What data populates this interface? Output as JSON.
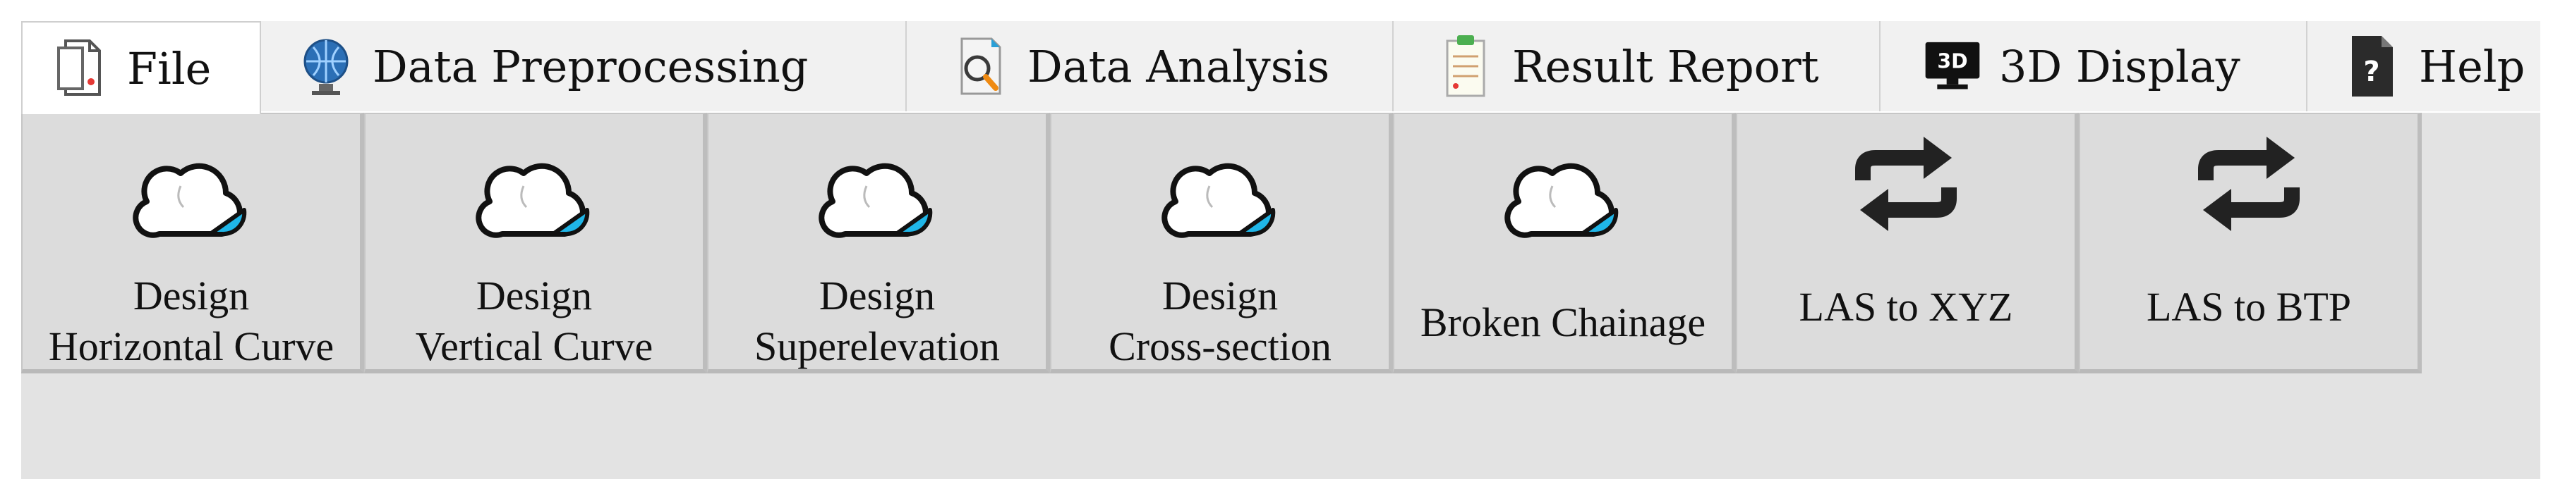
{
  "tabs": [
    {
      "label": "File",
      "icon": "document-icon",
      "active": true
    },
    {
      "label": "Data Preprocessing",
      "icon": "globe-icon"
    },
    {
      "label": "Data Analysis",
      "icon": "magnifier-icon"
    },
    {
      "label": "Result Report",
      "icon": "report-icon"
    },
    {
      "label": "3D Display",
      "icon": "monitor-3d-icon",
      "badge": "3D"
    },
    {
      "label": "Help",
      "icon": "help-document-icon",
      "badge": "?"
    }
  ],
  "toolbar": {
    "buttons": [
      {
        "line1": "Design",
        "line2": "Horizontal Curve",
        "icon": "cloud-icon"
      },
      {
        "line1": "Design",
        "line2": "Vertical Curve",
        "icon": "cloud-icon"
      },
      {
        "line1": "Design",
        "line2": "Superelevation",
        "icon": "cloud-icon"
      },
      {
        "line1": "Design",
        "line2": "Cross-section",
        "icon": "cloud-icon"
      },
      {
        "label": "Broken Chainage",
        "icon": "cloud-icon"
      },
      {
        "label": "LAS to XYZ",
        "icon": "convert-arrows-icon"
      },
      {
        "label": "LAS to BTP",
        "icon": "convert-arrows-icon"
      }
    ]
  },
  "colors": {
    "accent": "#1fb6e8",
    "ribbon": "#e3e3e3",
    "tabbar": "#f1f1f1"
  }
}
